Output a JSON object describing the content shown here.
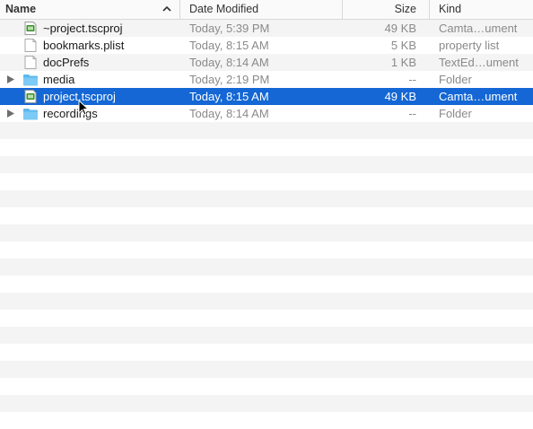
{
  "columns": {
    "name": "Name",
    "date": "Date Modified",
    "size": "Size",
    "kind": "Kind",
    "sort_indicator_icon": "chevron-up-icon"
  },
  "files": [
    {
      "name": "~project.tscproj",
      "date": "Today, 5:39 PM",
      "size": "49 KB",
      "kind": "Camta…ument",
      "icon": "camtasia-doc-icon"
    },
    {
      "name": "bookmarks.plist",
      "date": "Today, 8:15 AM",
      "size": "5 KB",
      "kind": "property list",
      "icon": "document-icon"
    },
    {
      "name": "docPrefs",
      "date": "Today, 8:14 AM",
      "size": "1 KB",
      "kind": "TextEd…ument",
      "icon": "document-icon"
    },
    {
      "name": "media",
      "date": "Today, 2:19 PM",
      "size": "--",
      "kind": "Folder",
      "icon": "folder-icon"
    },
    {
      "name": "project.tscproj",
      "date": "Today, 8:15 AM",
      "size": "49 KB",
      "kind": "Camta…ument",
      "icon": "camtasia-doc-icon",
      "selected": true
    },
    {
      "name": "recordings",
      "date": "Today, 8:14 AM",
      "size": "--",
      "kind": "Folder",
      "icon": "folder-icon"
    }
  ],
  "colors": {
    "selection": "#1467d4",
    "folder": "#5cb8f0",
    "camtasia_green": "#3a8f2e"
  }
}
